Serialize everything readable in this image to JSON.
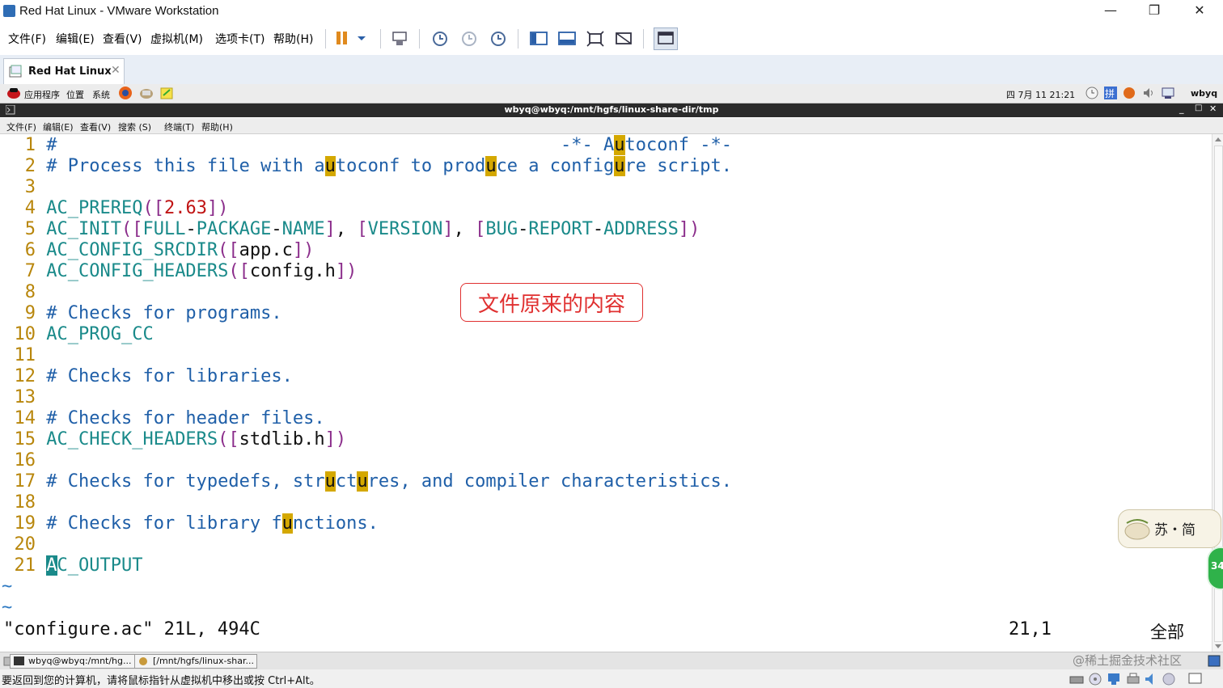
{
  "window": {
    "title": "Red Hat Linux - VMware Workstation",
    "controls": [
      "—",
      "❐",
      "✕"
    ]
  },
  "menubar": {
    "items": [
      "文件(F)",
      "编辑(E)",
      "查看(V)",
      "虚拟机(M)",
      "选项卡(T)",
      "帮助(H)"
    ]
  },
  "tab": {
    "label": "Red Hat Linux",
    "close": "✕"
  },
  "gnome_panel": {
    "items": [
      "应用程序",
      "位置",
      "系统"
    ],
    "clock": "四 7月 11 21:21",
    "user": "wbyq"
  },
  "terminal": {
    "title": "wbyq@wbyq:/mnt/hgfs/linux-share-dir/tmp",
    "menu": [
      "文件(F)",
      "编辑(E)",
      "查看(V)",
      "搜索 (S)",
      "终端(T)",
      "帮助(H)"
    ],
    "controls": [
      "_",
      "□",
      "✕"
    ]
  },
  "editor": {
    "line_numbers": [
      "1",
      "2",
      "3",
      "4",
      "5",
      "6",
      "7",
      "8",
      "9",
      "10",
      "11",
      "12",
      "13",
      "14",
      "15",
      "16",
      "17",
      "18",
      "19",
      "20",
      "21"
    ],
    "status_file": "\"configure.ac\" 21L, 494C",
    "cursor_pos": "21,1",
    "scroll_pos": "全部",
    "tilde": "~"
  },
  "annotation": {
    "text": "文件原来的内容",
    "color": "#e03030"
  },
  "taskbar": {
    "tasks": [
      "wbyq@wbyq:/mnt/hg...",
      "[/mnt/hgfs/linux-shar..."
    ]
  },
  "vmware_status": {
    "message": "要返回到您的计算机，请将鼠标指针从虚拟机中移出或按 Ctrl+Alt。"
  },
  "watermark": "@稀土掘金技术社区",
  "badge": {
    "text": "苏・简",
    "number": "34"
  },
  "colors": {
    "comment": "#1f5fa8",
    "keyword": "#1a8a8a",
    "bracket": "#8b2d8b",
    "number": "#c01414",
    "search_highlight": "#d4a800",
    "cursor": "#1a8a8a",
    "line_number": "#b8860b"
  }
}
